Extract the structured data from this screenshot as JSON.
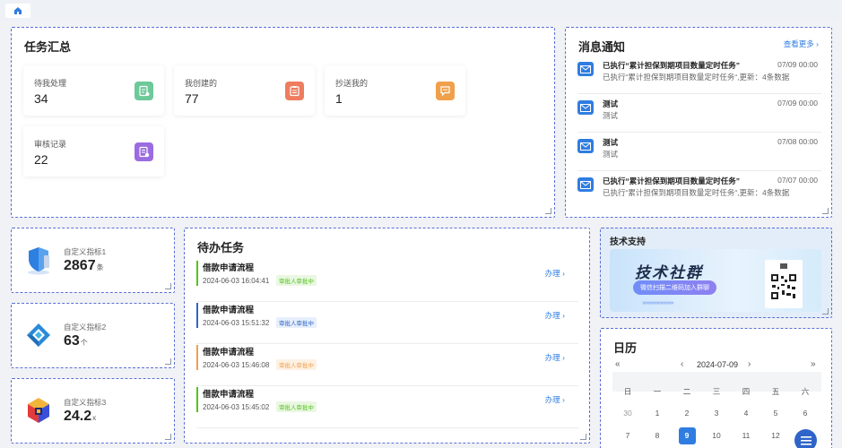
{
  "topbar": {
    "home_icon": "home-icon"
  },
  "task_summary": {
    "title": "任务汇总",
    "cards": [
      {
        "label": "待我处理",
        "value": "34",
        "icon": "pending-icon",
        "color": "#6dc999"
      },
      {
        "label": "我创建的",
        "value": "77",
        "icon": "created-icon",
        "color": "#ee7d5f"
      },
      {
        "label": "抄送我的",
        "value": "1",
        "icon": "cc-icon",
        "color": "#f0a04b"
      },
      {
        "label": "审核记录",
        "value": "22",
        "icon": "audit-icon",
        "color": "#9b6ce0"
      }
    ]
  },
  "messages": {
    "title": "消息通知",
    "more": "查看更多",
    "items": [
      {
        "title": "已执行“累计担保到期项目数量定时任务”",
        "body": "已执行“累计担保到期项目数量定时任务“,更新：4条数据",
        "date": "07/09 00:00"
      },
      {
        "title": "测试",
        "body": "测试",
        "date": "07/09 00:00"
      },
      {
        "title": "测试",
        "body": "测试",
        "date": "07/08 00:00"
      },
      {
        "title": "已执行“累计担保到期项目数量定时任务”",
        "body": "已执行“累计担保到期项目数量定时任务“,更新：4条数据",
        "date": "07/07 00:00"
      }
    ]
  },
  "metrics": [
    {
      "label": "自定义指标1",
      "value": "2867",
      "unit": "条",
      "icon": "shield-icon"
    },
    {
      "label": "自定义指标2",
      "value": "63",
      "unit": "个",
      "icon": "diamond-layers-icon"
    },
    {
      "label": "自定义指标3",
      "value": "24.2",
      "unit": "x",
      "icon": "cube-icon"
    }
  ],
  "todo": {
    "title": "待办任务",
    "items": [
      {
        "name": "借款申请流程",
        "date": "2024-06-03 16:04:41",
        "tag": "审批人审批中",
        "action": "办理",
        "color": "#52c41a"
      },
      {
        "name": "借款申请流程",
        "date": "2024-06-03 15:51:32",
        "tag": "审批人审批中",
        "action": "办理",
        "color": "#2f64c9"
      },
      {
        "name": "借款申请流程",
        "date": "2024-06-03 15:46:08",
        "tag": "审批人审批中",
        "action": "办理",
        "color": "#f0a04b"
      },
      {
        "name": "借款申请流程",
        "date": "2024-06-03 15:45:02",
        "tag": "审批人审批中",
        "action": "办理",
        "color": "#52c41a"
      }
    ]
  },
  "support": {
    "title": "技术支持",
    "headline": "技术社群",
    "pill": "微信扫描二维码加入群聊"
  },
  "calendar": {
    "title": "日历",
    "month": "2024-07-09",
    "prev_year": "«",
    "prev_month": "‹",
    "next_month": "›",
    "next_year": "»",
    "weekdays": [
      "日",
      "一",
      "二",
      "三",
      "四",
      "五",
      "六"
    ],
    "row1": [
      "30",
      "1",
      "2",
      "3",
      "4",
      "5",
      "6"
    ],
    "row2": [
      "7",
      "8",
      "9",
      "10",
      "11",
      "12",
      ""
    ],
    "selected": "9"
  }
}
